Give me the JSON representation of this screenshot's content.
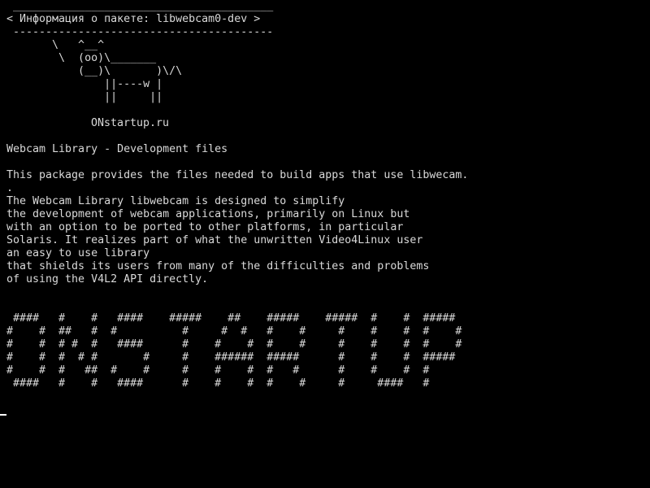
{
  "terminal": {
    "cowsay_art": " ________________________________________\n< Информация о пакете: libwebcam0-dev >\n ----------------------------------------\n       \\   ^__^\n        \\  (oo)\\_______\n           (__)\\       )\\/\\\n               ||----w |\n               ||     ||",
    "website": "ONstartup.ru",
    "package_summary": "Webcam Library - Development files",
    "package_description": "This package provides the files needed to build apps that use libwecam.\n.\nThe Webcam Library libwebcam is designed to simplify\nthe development of webcam applications, primarily on Linux but\nwith an option to be ported to other platforms, in particular\nSolaris. It realizes part of what the unwritten Video4Linux user\nan easy to use library\nthat shields its users from many of the difficulties and problems\nof using the V4L2 API directly.",
    "banner_art": " ####   #    #   ####    #####    ##    #####    #####  #    #  #####\n#    #  ##   #  #          #     #  #   #    #     #    #    #  #    #\n#    #  # #  #   ####      #    #    #  #    #     #    #    #  #    #\n#    #  #  # #       #     #    ######  #####      #    #    #  #####\n#    #  #   ##  #    #     #    #    #  #   #      #    #    #  #\n ####   #    #   ####      #    #    #  #    #     #     ####   #",
    "cursor": "_"
  }
}
